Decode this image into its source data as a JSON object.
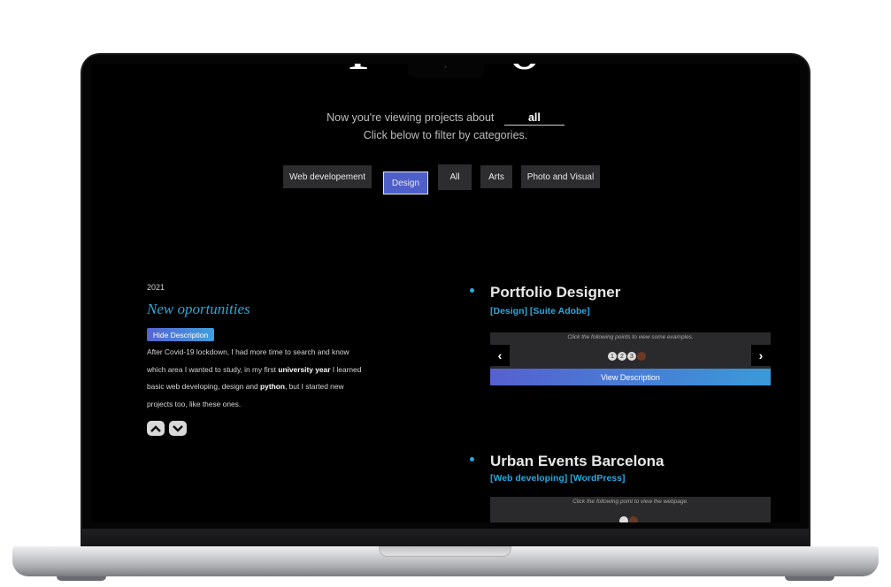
{
  "page": {
    "title_partial": "Projects",
    "viewing_prefix": "Now you're viewing projects about",
    "current_filter": "all",
    "instruction": "Click below to filter by categories."
  },
  "categories": [
    {
      "label": "Web developement",
      "active": false
    },
    {
      "label": "Design",
      "active": true
    },
    {
      "label": "All",
      "active": false
    },
    {
      "label": "Arts",
      "active": false
    },
    {
      "label": "Photo and Visual",
      "active": false
    }
  ],
  "timeline": {
    "year": "2021",
    "title": "New oportunities",
    "hide_button": "Hide Description",
    "description": {
      "part1": "After Covid-19 lockdown, I had more time to search and know which area I wanted to study, in my first ",
      "bold1": "university year",
      "part2": " I learned basic web developing, design and ",
      "bold2": "python",
      "part3": ", but I started new projects too, like these ones."
    }
  },
  "projects": [
    {
      "title": "Portfolio Designer",
      "tags": "[Design] [Suite Adobe]",
      "gallery_hint": "Click the following points to view some examples.",
      "dots": [
        "1",
        "2",
        "3"
      ],
      "prev_label": "‹",
      "next_label": "›",
      "view_button": "View Description"
    },
    {
      "title": "Urban Events Barcelona",
      "tags": "[Web developing] [WordPress]",
      "gallery_hint": "Click the following point to view the webpage."
    }
  ],
  "colors": {
    "accent": "#27a8e0",
    "active_category": "#4f5fc9"
  }
}
